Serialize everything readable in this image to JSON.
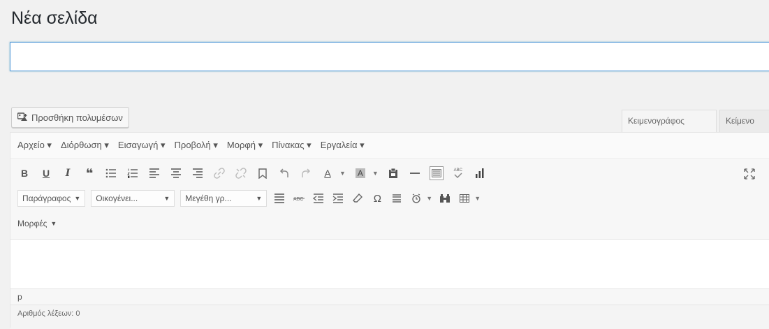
{
  "page_title": "Νέα σελίδα",
  "title_input": {
    "value": "",
    "placeholder": ""
  },
  "media_button": {
    "label": "Προσθήκη πολυμέσων",
    "icon": "add-media-icon"
  },
  "tabs": [
    {
      "label": "Κειμενογράφος",
      "active": true
    },
    {
      "label": "Κείμενο",
      "active": false
    }
  ],
  "menubar": {
    "items": [
      "Αρχείο ▾",
      "Διόρθωση ▾",
      "Εισαγωγή ▾",
      "Προβολή ▾",
      "Μορφή ▾",
      "Πίνακας ▾",
      "Εργαλεία ▾"
    ]
  },
  "toolbar": {
    "bold": "B",
    "underline": "U",
    "italic": "I",
    "blockquote": "❝",
    "strike_abbr": "ABC",
    "format_select": "Παράγραφος",
    "font_select": "Οικογένει...",
    "size_select": "Μεγέθη γρ...",
    "styles_select": "Μορφές",
    "omega": "Ω"
  },
  "path": "p",
  "word_count": "Αριθμός λέξεων: 0"
}
